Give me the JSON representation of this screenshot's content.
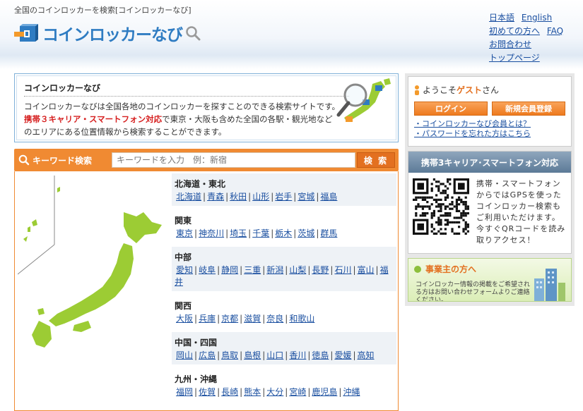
{
  "header": {
    "tagline": "全国のコインロッカーを検索[コインロッカーなび]",
    "logo_text": "コインロッカーなび",
    "links": {
      "japanese": "日本語",
      "english": "English",
      "first_time": "初めての方へ",
      "faq": "FAQ",
      "contact": "お問合わせ",
      "top_page": "トップページ"
    }
  },
  "intro": {
    "title": "コインロッカーなび",
    "line1": "コインロッカーなびは全国各地のコインロッカーを探すことのできる検索サイトです。",
    "highlight": "携帯３キャリア・スマートフォン対応",
    "line2": "で東京・大阪も含めた全国の各駅・観光地など",
    "line3": "のエリアにある位置情報から検索することができます。"
  },
  "search": {
    "label": "キーワード検索",
    "placeholder": "キーワードを入力　例：新宿",
    "button": "検 索"
  },
  "regions": [
    {
      "name": "北海道・東北",
      "prefs": [
        "北海道",
        "青森",
        "秋田",
        "山形",
        "岩手",
        "宮城",
        "福島"
      ]
    },
    {
      "name": "関東",
      "prefs": [
        "東京",
        "神奈川",
        "埼玉",
        "千葉",
        "栃木",
        "茨城",
        "群馬"
      ]
    },
    {
      "name": "中部",
      "prefs": [
        "愛知",
        "岐阜",
        "静岡",
        "三重",
        "新潟",
        "山梨",
        "長野",
        "石川",
        "富山",
        "福井"
      ]
    },
    {
      "name": "関西",
      "prefs": [
        "大阪",
        "兵庫",
        "京都",
        "滋賀",
        "奈良",
        "和歌山"
      ]
    },
    {
      "name": "中国・四国",
      "prefs": [
        "岡山",
        "広島",
        "鳥取",
        "島根",
        "山口",
        "香川",
        "徳島",
        "愛媛",
        "高知"
      ]
    },
    {
      "name": "九州・沖縄",
      "prefs": [
        "福岡",
        "佐賀",
        "長崎",
        "熊本",
        "大分",
        "宮崎",
        "鹿児島",
        "沖縄"
      ]
    }
  ],
  "login": {
    "welcome_prefix": "ようこそ",
    "guest": "ゲスト",
    "welcome_suffix": "さん",
    "login_button": "ログイン",
    "register_button": "新規会員登録",
    "member_link": "・コインロッカーなび会員とは？",
    "forgot_link": "・パスワードを忘れた方はこちら"
  },
  "mobile": {
    "heading": "携帯3キャリア･スマートフォン対応",
    "text": "携帯・スマートフォンからではGPSを使ったコインロッカー検索もご利用いただけます。今すぐQRコードを読み取りアクセス！"
  },
  "business": {
    "title": "事業主の方へ",
    "desc": "コインロッカー情報の掲載をご希望される方はお問い合わせフォームよりご連絡ください。"
  },
  "colors": {
    "accent_orange": "#f08a32",
    "brand_blue": "#2f7cc2",
    "map_green": "#9ccc34"
  }
}
